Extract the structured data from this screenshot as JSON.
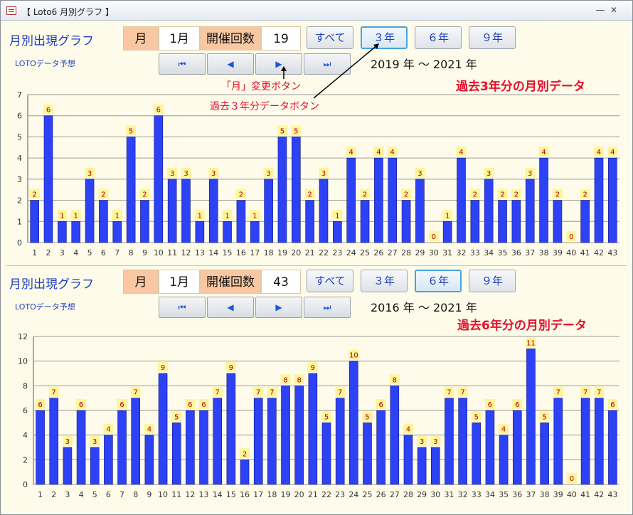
{
  "window": {
    "title": "【 Loto6 月別グラフ 】",
    "minimize_label": "―",
    "close_label": "✕"
  },
  "colors": {
    "bar": "#2d41f5",
    "label_bg": "#fff59a",
    "label_text": "#b00000",
    "accent_red": "#e3102a",
    "blue_text": "#1d3fbf"
  },
  "panels": [
    {
      "title": "月別出現グラフ",
      "predict": "LOTOデータ予想",
      "month_label": "月",
      "month_value": "1月",
      "count_label": "開催回数",
      "count_value": "19",
      "buttons": {
        "all": "すべて",
        "y3": "３年",
        "y6": "６年",
        "y9": "９年"
      },
      "active_button": "y3",
      "nav": {
        "first": "⏮",
        "prev": "◀",
        "next": "▶",
        "last": "⏭"
      },
      "range": "2019 年 ～ 2021 年",
      "annotation": "過去3年分の月別データ",
      "callouts": {
        "next": "「月」変更ボタン",
        "y3": "過去３年分データボタン"
      }
    },
    {
      "title": "月別出現グラフ",
      "predict": "LOTOデータ予想",
      "month_label": "月",
      "month_value": "1月",
      "count_label": "開催回数",
      "count_value": "43",
      "buttons": {
        "all": "すべて",
        "y3": "３年",
        "y6": "６年",
        "y9": "９年"
      },
      "active_button": "y6",
      "nav": {
        "first": "⏮",
        "prev": "◀",
        "next": "▶",
        "last": "⏭"
      },
      "range": "2016 年 ～ 2021 年",
      "annotation": "過去6年分の月別データ"
    }
  ],
  "chart_data": [
    {
      "type": "bar",
      "categories": [
        "1",
        "2",
        "3",
        "4",
        "5",
        "6",
        "7",
        "8",
        "9",
        "10",
        "11",
        "12",
        "13",
        "14",
        "15",
        "16",
        "17",
        "18",
        "19",
        "20",
        "21",
        "22",
        "23",
        "24",
        "25",
        "26",
        "27",
        "28",
        "29",
        "30",
        "31",
        "32",
        "33",
        "34",
        "35",
        "36",
        "37",
        "38",
        "39",
        "40",
        "41",
        "42",
        "43"
      ],
      "values": [
        2,
        6,
        1,
        1,
        3,
        2,
        1,
        5,
        2,
        6,
        3,
        3,
        1,
        3,
        1,
        2,
        1,
        3,
        5,
        5,
        2,
        3,
        1,
        4,
        2,
        4,
        4,
        2,
        3,
        0,
        1,
        4,
        2,
        3,
        2,
        2,
        3,
        4,
        2,
        0,
        2,
        4,
        4
      ],
      "ylim": [
        0,
        7
      ],
      "yticks": [
        "0",
        "1",
        "2",
        "3",
        "4",
        "5",
        "6",
        "7"
      ],
      "grid": true
    },
    {
      "type": "bar",
      "categories": [
        "1",
        "2",
        "3",
        "4",
        "5",
        "6",
        "7",
        "8",
        "9",
        "10",
        "11",
        "12",
        "13",
        "14",
        "15",
        "16",
        "17",
        "18",
        "19",
        "20",
        "21",
        "22",
        "23",
        "24",
        "25",
        "26",
        "27",
        "28",
        "29",
        "30",
        "31",
        "32",
        "33",
        "34",
        "35",
        "36",
        "37",
        "38",
        "39",
        "40",
        "41",
        "42",
        "43"
      ],
      "values": [
        6,
        7,
        3,
        6,
        3,
        4,
        6,
        7,
        4,
        9,
        5,
        6,
        6,
        7,
        9,
        2,
        7,
        7,
        8,
        8,
        9,
        5,
        7,
        10,
        5,
        6,
        8,
        4,
        3,
        3,
        7,
        7,
        5,
        6,
        4,
        6,
        11,
        5,
        7,
        0,
        7,
        7,
        6
      ],
      "ylim": [
        0,
        12
      ],
      "yticks": [
        "0",
        "2",
        "4",
        "6",
        "8",
        "10",
        "12"
      ],
      "grid": true
    }
  ]
}
